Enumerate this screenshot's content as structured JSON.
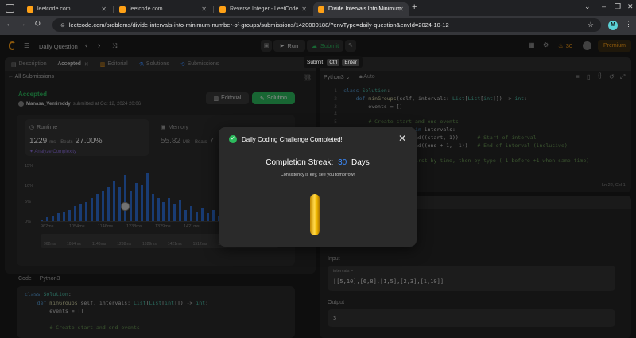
{
  "browser": {
    "tabs": [
      {
        "title": "leetcode.com",
        "active": false
      },
      {
        "title": "leetcode.com",
        "active": false
      },
      {
        "title": "Reverse Integer - LeetCode",
        "active": false
      },
      {
        "title": "Divide Intervals Into Minimum N",
        "active": true
      }
    ],
    "url": "leetcode.com/problems/divide-intervals-into-minimum-number-of-groups/submissions/1420000188/?envType=daily-question&envId=2024-10-12",
    "profile_initial": "M"
  },
  "header": {
    "title": "Daily Question",
    "run_label": "Run",
    "submit_label": "Submit",
    "streak_count": "30",
    "premium_label": "Premium",
    "tooltip": {
      "label": "Submit",
      "keys": [
        "Ctrl",
        "Enter"
      ]
    }
  },
  "left": {
    "tabs": [
      "Description",
      "Accepted",
      "Editorial",
      "Solutions",
      "Submissions"
    ],
    "back_label": "All Submissions",
    "status": "Accepted",
    "user": "Manasa_Vemireddy",
    "submitted_at": "submitted at Oct 12, 2024 20:06",
    "editorial_btn": "Editorial",
    "solution_btn": "Solution",
    "runtime": {
      "label": "Runtime",
      "value": "1229",
      "unit": "ms",
      "beats_label": "Beats",
      "beats": "27.00%",
      "analyze": "Analyze Complexity"
    },
    "memory": {
      "label": "Memory",
      "value": "55.82",
      "unit": "MB",
      "beats_label": "Beats",
      "beats": "7"
    },
    "chart_y": [
      "15%",
      "10%",
      "5%",
      "0%"
    ],
    "chart_x": [
      "962ms",
      "1054ms",
      "1146ms",
      "1238ms",
      "1329ms",
      "1421ms"
    ],
    "chart_x2": [
      "962ms",
      "1054ms",
      "1146ms",
      "1238ms",
      "1329ms",
      "1421ms",
      "1512ms",
      "1604ms"
    ],
    "code_label": "Code",
    "code_lang": "Python3",
    "code_lines": [
      "class Solution:",
      "    def minGroups(self, intervals: List[List[int]]) -> int:",
      "        events = []",
      "",
      "        # Create start and end events"
    ]
  },
  "right": {
    "lang": "Python3",
    "auto": "Auto",
    "line_numbers": [
      "1",
      "2",
      "3",
      "4",
      "5",
      "6",
      "7",
      "8",
      "9",
      "10",
      "11"
    ],
    "code_lines": [
      "class Solution:",
      "    def minGroups(self, intervals: List[List[int]]) -> int:",
      "        events = []",
      "",
      "        # Create start and end events",
      "        for start, end in intervals:",
      "            events.append((start, 1))      # Start of interval",
      "            events.append((end + 1, -1))   # End of interval (inclusive)",
      "",
      "        # Sort events first by time, then by type (-1 before +1 when same time)",
      "        events.sort()"
    ],
    "cursor": "Ln 22, Col 1",
    "input_label": "Input",
    "var_label": "intervals =",
    "var_value": "[[5,10],[6,8],[1,5],[2,3],[1,10]]",
    "output_label": "Output",
    "output_value": "3"
  },
  "modal": {
    "title": "Daily Coding Challenge Completed!",
    "streak_prefix": "Completion Streak:",
    "streak_number": "30",
    "streak_suffix": "Days",
    "message": "Consistency is key, see you tomorrow!"
  },
  "colors": {
    "accent_green": "#2cbb5d",
    "accent_blue": "#3c8cff",
    "streak_orange": "#ffa116",
    "bar_blue": "#2f6dd3"
  },
  "chart_data": {
    "type": "bar",
    "title": "",
    "xlabel": "",
    "ylabel": "",
    "ylim": [
      0,
      15
    ],
    "categories": [
      "962ms",
      "",
      "",
      "",
      "",
      "",
      "",
      "",
      "1054ms",
      "",
      "",
      "",
      "",
      "",
      "",
      "",
      "",
      "1146ms",
      "",
      "",
      "",
      "",
      "",
      "",
      "",
      "",
      "1238ms",
      "",
      "",
      "",
      "",
      "",
      "",
      "",
      "1329ms",
      "",
      "",
      "",
      "",
      "",
      "",
      "",
      "1421ms"
    ],
    "values": [
      0.5,
      1,
      1.5,
      2,
      2.5,
      3,
      4,
      4.5,
      5,
      6,
      7,
      8,
      9,
      10.5,
      9,
      12,
      8,
      10,
      9.5,
      12.5,
      7,
      6,
      5,
      6,
      4.5,
      5.5,
      3,
      4,
      2.5,
      3.5,
      2,
      3,
      1.5,
      2.5,
      1.5,
      1,
      2,
      1,
      0.8,
      1.5,
      0.5,
      0.5,
      0.3
    ]
  }
}
